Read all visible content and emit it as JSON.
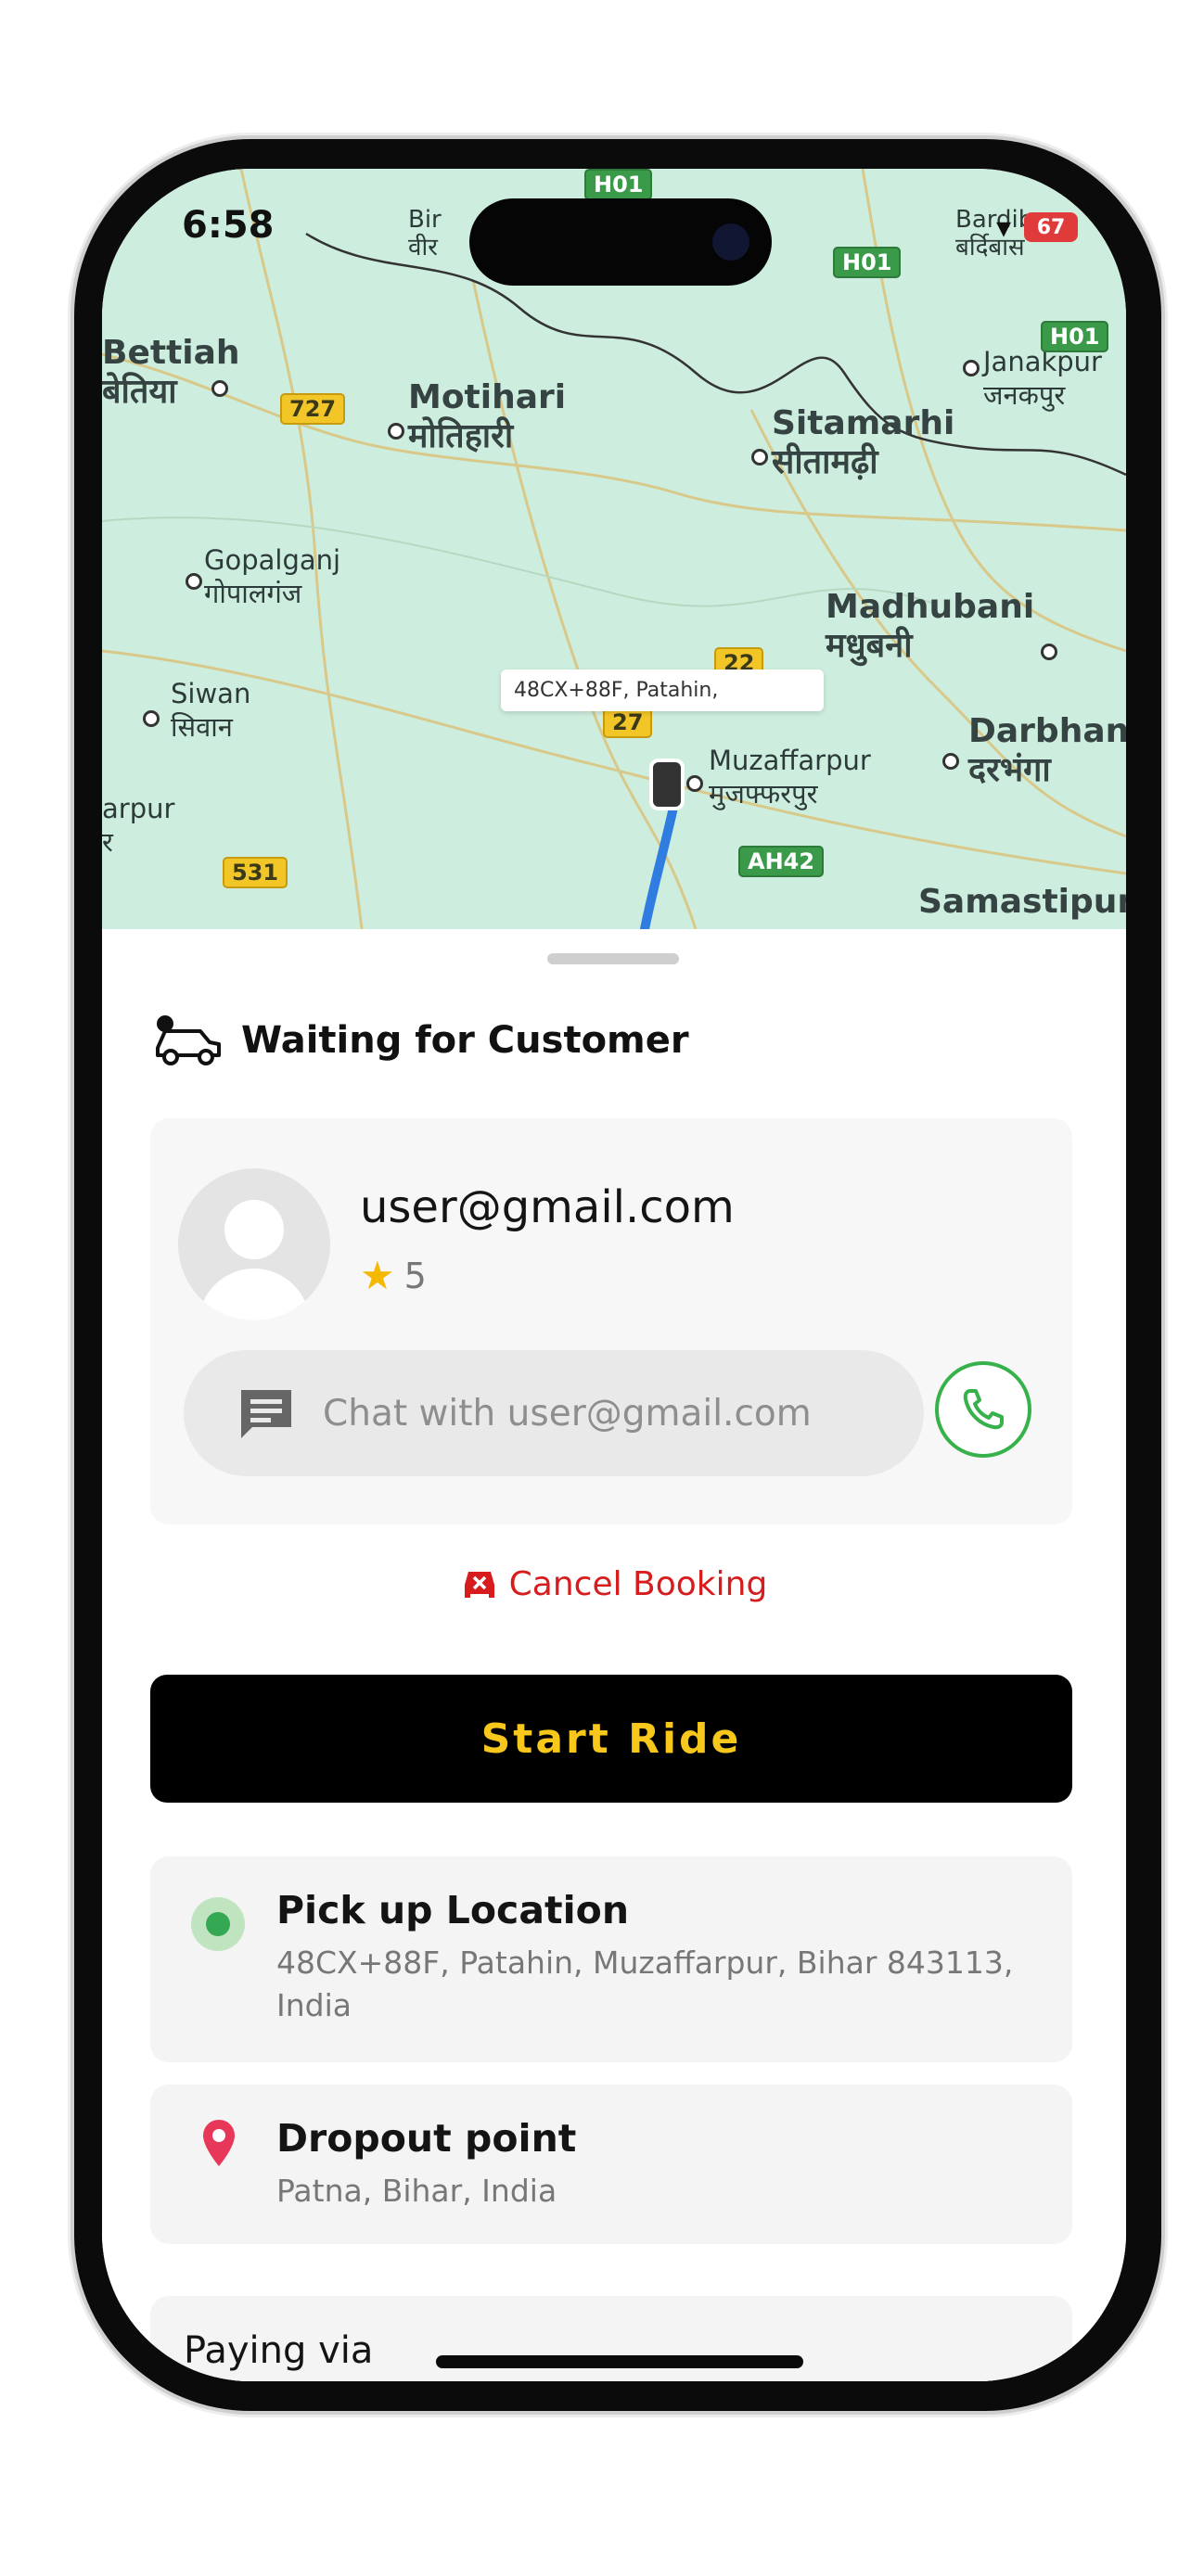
{
  "status_bar": {
    "time": "6:58",
    "battery": "67"
  },
  "map": {
    "tooltip": "48CX+88F, Patahin,",
    "places": [
      {
        "en": "Bettiah",
        "hi": "बेतिया"
      },
      {
        "en": "Motihari",
        "hi": "मोतिहारी"
      },
      {
        "en": "Sitamarhi",
        "hi": "सीतामढ़ी"
      },
      {
        "en": "Janakpur",
        "hi": "जनकपुर"
      },
      {
        "en": "Gopalganj",
        "hi": "गोपालगंज"
      },
      {
        "en": "Madhubani",
        "hi": "मधुबनी"
      },
      {
        "en": "Siwan",
        "hi": "सिवान"
      },
      {
        "en": "Darbhan",
        "hi": "दरभंगा"
      },
      {
        "en": "Muzaffarpur",
        "hi": "मुजफ्फरपुर"
      },
      {
        "en": "arpur",
        "hi": "र"
      },
      {
        "en": "Samastipur",
        "hi": ""
      },
      {
        "en": "Bardibas",
        "hi": "बर्दिबास"
      },
      {
        "en": "Bir",
        "hi": "वीर"
      }
    ],
    "shields": [
      "H01",
      "H01",
      "H01",
      "727",
      "22",
      "27",
      "531",
      "AH42"
    ]
  },
  "sheet": {
    "title": "Waiting for Customer",
    "user": {
      "email": "user@gmail.com",
      "rating": "5",
      "chat_placeholder": "Chat with user@gmail.com"
    },
    "cancel_label": "Cancel Booking",
    "start_label": "Start Ride",
    "pickup": {
      "title": "Pick up Location",
      "address": "48CX+88F, Patahin, Muzaffarpur, Bihar 843113, India"
    },
    "dropoff": {
      "title": "Dropout point",
      "address": "Patna, Bihar, India"
    },
    "paying_label": "Paying via"
  },
  "colors": {
    "accent_yellow": "#f7c71c",
    "cancel_red": "#d61c1c",
    "call_green": "#37b14a",
    "pickup_green": "#34a853",
    "drop_pin": "#e8385a"
  }
}
